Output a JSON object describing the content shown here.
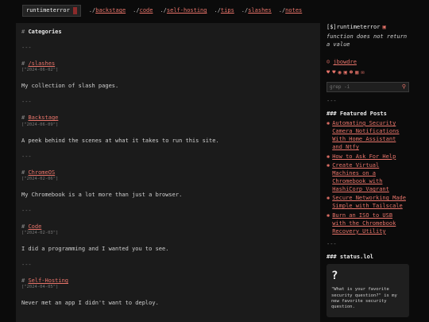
{
  "nav": {
    "brand": "runtimeterror",
    "links": [
      {
        "prefix": "./",
        "label": "backstage"
      },
      {
        "prefix": "./",
        "label": "code"
      },
      {
        "prefix": "./",
        "label": "self-hosting"
      },
      {
        "prefix": "./",
        "label": "tips"
      },
      {
        "prefix": "./",
        "label": "slashes"
      },
      {
        "prefix": "./",
        "label": "notes"
      }
    ]
  },
  "main": {
    "heading": "Categories",
    "separator": "---",
    "entries": [
      {
        "title": "/slashes",
        "date": "[\"2024-06-02\"]",
        "desc": "My collection of slash pages."
      },
      {
        "title": "Backstage",
        "date": "[\"2024-06-09\"]",
        "desc": "A peek behind the scenes at what it takes to run this site."
      },
      {
        "title": "ChromeOS",
        "date": "[\"2024-02-06\"]",
        "desc": "My Chromebook is a lot more than just a browser."
      },
      {
        "title": "Code",
        "date": "[\"2024-02-03\"]",
        "desc": "I did a programming and I wanted you to see."
      },
      {
        "title": "Self-Hosting",
        "date": "[\"2024-04-05\"]",
        "desc": "Never met an app I didn't want to deploy."
      }
    ]
  },
  "sidebar": {
    "site_title": "[$]runtimeterror",
    "tagline": "function does not return a value",
    "user": "jbowdre",
    "search_placeholder": "grep -i",
    "separator": "---",
    "featured_heading": "### Featured Posts",
    "posts": [
      "Automating Security Camera Notifications With Home Assistant and Ntfy",
      "How to Ask For Help",
      "Create Virtual Machines on a Chromebook with HashiCorp Vagrant",
      "Secure Networking Made Simple with Tailscale",
      "Burn an ISO to USB with the Chromebook Recovery Utility"
    ],
    "status_heading": "### status.lol",
    "status_emoji": "?",
    "status_text": "\"What is your favorite security question?\" is my new favorite security question."
  },
  "colors": {
    "accent": "#e8746a",
    "panel": "#1b1b1b",
    "background": "#0b0b0b"
  },
  "icons": [
    "rss-icon",
    "user-icon",
    "heart-icon",
    "github-icon",
    "mastodon-icon",
    "omg-icon",
    "matrix-icon",
    "mail-icon",
    "search-icon"
  ]
}
